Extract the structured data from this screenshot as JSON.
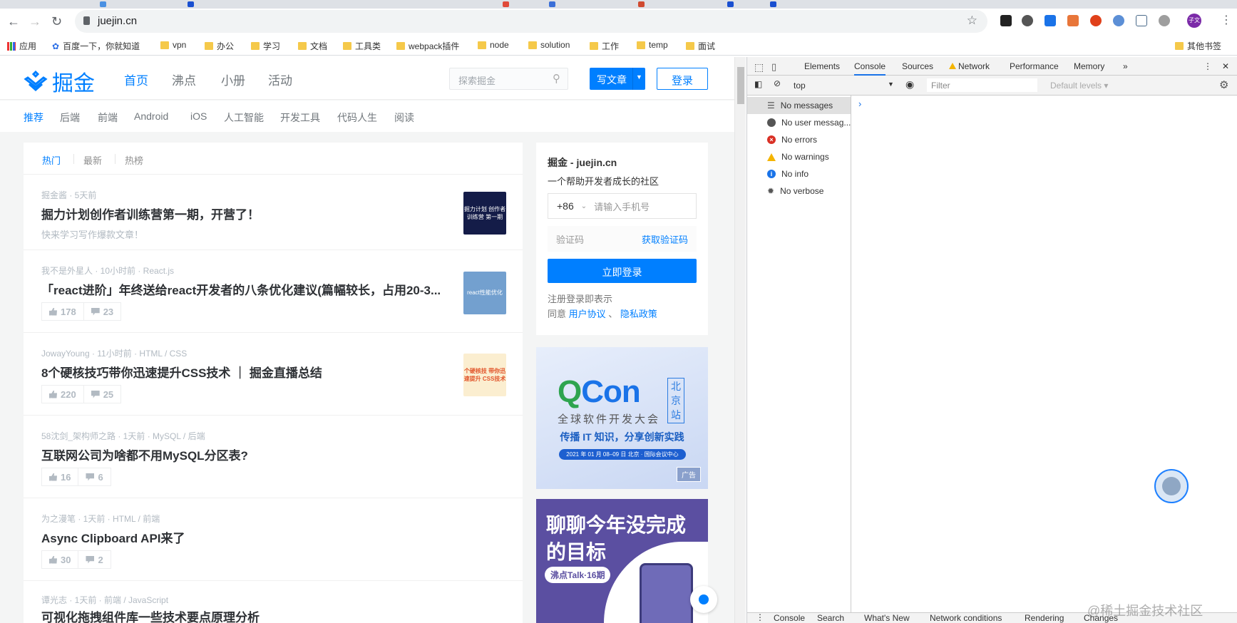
{
  "browser": {
    "url": "juejin.cn",
    "profile_initials": "子文",
    "bookmarks": [
      "应用",
      "百度一下，你就知道",
      "vpn",
      "办公",
      "学习",
      "文档",
      "工具类",
      "webpack插件",
      "node",
      "solution",
      "工作",
      "temp",
      "面试"
    ],
    "other_bookmarks": "其他书签"
  },
  "juejin": {
    "logo_text": "掘金",
    "nav": [
      "首页",
      "沸点",
      "小册",
      "活动"
    ],
    "search_placeholder": "探索掘金",
    "write_label": "写文章",
    "login_label": "登录",
    "categories": [
      "推荐",
      "后端",
      "前端",
      "Android",
      "iOS",
      "人工智能",
      "开发工具",
      "代码人生",
      "阅读"
    ],
    "list_tabs": [
      "热门",
      "最新",
      "热榜"
    ],
    "articles": [
      {
        "meta": "掘金酱 · 5天前",
        "title": "掘力计划创作者训练营第一期，开营了！",
        "abstract": "快来学习写作爆款文章！",
        "thumb": "掘力计划 创作者训练营 第一期"
      },
      {
        "meta": "我不是外星人 · 10小时前 · React.js",
        "title": "「react进阶」年终送给react开发者的八条优化建议(篇幅较长，占用20-3...",
        "likes": "178",
        "comments": "23",
        "thumb": "react性能优化"
      },
      {
        "meta": "JowayYoung · 11小时前 · HTML / CSS",
        "title": "8个硬核技巧带你迅速提升CSS技术 ｜ 掘金直播总结",
        "likes": "220",
        "comments": "25",
        "thumb": "个硬核技 带你迅速提升 CSS技术"
      },
      {
        "meta": "58沈剑_架构师之路 · 1天前 · MySQL / 后端",
        "title": "互联网公司为啥都不用MySQL分区表?",
        "likes": "16",
        "comments": "6"
      },
      {
        "meta": "为之漫笔 · 1天前 · HTML / 前端",
        "title": "Async Clipboard API来了",
        "likes": "30",
        "comments": "2"
      },
      {
        "meta": "谭光志 · 1天前 · 前端 / JavaScript",
        "title": "可视化拖拽组件库一些技术要点原理分析"
      }
    ],
    "login_card": {
      "title": "掘金 - juejin.cn",
      "subtitle": "一个帮助开发者成长的社区",
      "country_code": "+86",
      "phone_placeholder": "请输入手机号",
      "code_placeholder": "验证码",
      "get_code": "获取验证码",
      "submit": "立即登录",
      "terms_line1": "注册登录即表示",
      "terms_agree": "同意",
      "user_agreement": "用户协议",
      "sep": "、",
      "privacy": "隐私政策"
    },
    "ad1": {
      "brand_a": "Q",
      "brand_b": "Con",
      "station": "北京站",
      "subtitle": "全球软件开发大会",
      "slogan": "传播 IT 知识，分享创新实践",
      "date": "2021 年 01 月 08–09 日  北京 · 国际会议中心",
      "tag": "广告"
    },
    "ad2": {
      "title_line1": "聊聊今年没完成",
      "title_line2": "的目标",
      "pill": "沸点Talk·16期"
    }
  },
  "devtools": {
    "tabs": [
      "Elements",
      "Console",
      "Sources",
      "Network",
      "Performance",
      "Memory"
    ],
    "active_tab": "Console",
    "context": "top",
    "filter_placeholder": "Filter",
    "levels": "Default levels ▾",
    "sidebar": [
      "No messages",
      "No user messag...",
      "No errors",
      "No warnings",
      "No info",
      "No verbose"
    ],
    "drawer_tabs": [
      "Console",
      "Search",
      "What's New",
      "Network conditions",
      "Rendering",
      "Changes"
    ]
  },
  "watermark": "@稀土掘金技术社区"
}
